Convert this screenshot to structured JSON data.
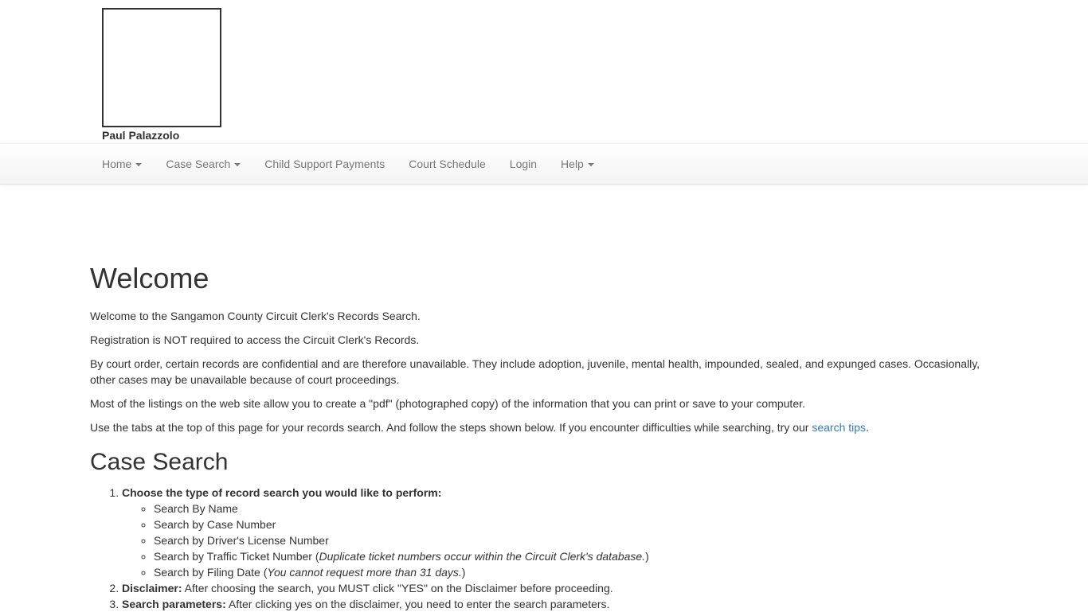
{
  "header": {
    "owner_name": "Paul Palazzolo"
  },
  "nav": {
    "home": "Home",
    "case_search": "Case Search",
    "child_support": "Child Support Payments",
    "court_schedule": "Court Schedule",
    "login": "Login",
    "help": "Help"
  },
  "welcome": {
    "title": "Welcome",
    "p1": "Welcome to the Sangamon County Circuit Clerk's Records Search.",
    "p2": "Registration is NOT required to access the Circuit Clerk's Records.",
    "p3": "By court order, certain records are confidential and are therefore unavailable. They include adoption, juvenile, mental health, impounded, sealed, and expunged cases. Occasionally, other cases may be unavailable because of court proceedings.",
    "p4": "Most of the listings on the web site allow you to create a \"pdf\" (photographed copy) of the information that you can print or save to your computer.",
    "p5_prefix": "Use the tabs at the top of this page for your records search. And follow the steps shown below. If you encounter difficulties while searching, try our ",
    "p5_link": "search tips",
    "p5_suffix": "."
  },
  "case_search": {
    "title": "Case Search",
    "step1_label": "Choose the type of record search you would like to perform:",
    "options": [
      "Search By Name",
      "Search by Case Number",
      "Search by Driver's License Number",
      "Search by Traffic Ticket Number (",
      "Search by Filing Date ("
    ],
    "ticket_note": "Duplicate ticket numbers occur within the Circuit Clerk's database.",
    "filing_note": "You cannot request more than 31 days.",
    "close_paren": ")",
    "step2_label": "Disclaimer:",
    "step2_text": " After choosing the search, you MUST click \"YES\" on the Disclaimer before proceeding.",
    "step3_label": "Search parameters:",
    "step3_text": " After clicking yes on the disclaimer, you need to enter the search parameters."
  }
}
